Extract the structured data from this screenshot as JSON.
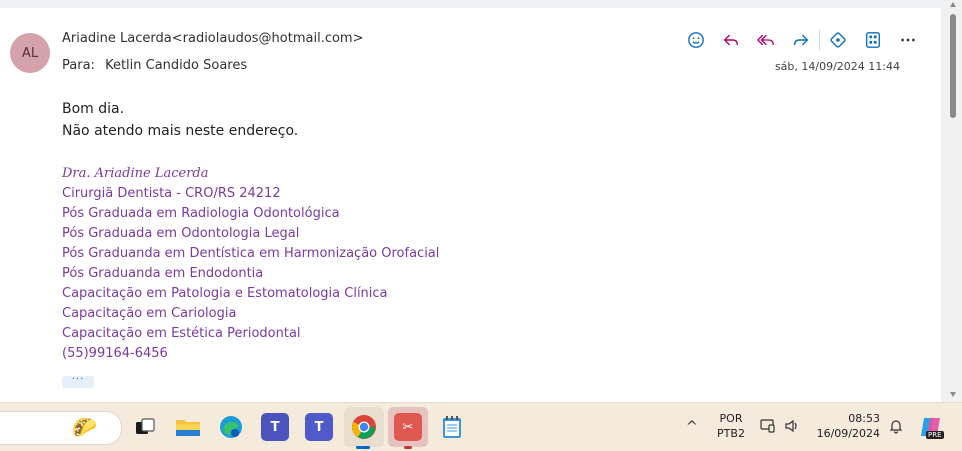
{
  "email": {
    "avatar_initials": "AL",
    "from": "Ariadine Lacerda<radiolaudos@hotmail.com>",
    "to_label": "Para:",
    "to": "Ketlin Candido Soares",
    "date": "sáb, 14/09/2024 11:44",
    "body_lines": [
      "Bom dia.",
      "Não atendo mais neste endereço."
    ],
    "signature": [
      "Dra. Ariadine Lacerda",
      "Cirurgiã Dentista - CRO/RS 24212",
      "Pós Graduada em Radiologia Odontológica",
      "Pós Graduada em Odontologia Legal",
      "Pós Graduanda em Dentística em Harmonização Orofacial",
      "Pós Graduanda em Endodontia",
      "Capacitação em Patologia e Estomatologia Clínica",
      "Capacitação em Cariologia",
      "Capacitação em Estética Periodontal",
      "(55)99164-6456"
    ],
    "more_label": "···",
    "actions": [
      "emoji-icon",
      "reply-icon",
      "reply-all-icon",
      "forward-icon",
      "apps-icon",
      "immersive-reader-icon",
      "more-icon"
    ]
  },
  "taskbar": {
    "apps": [
      "taco-widget",
      "task-view",
      "file-explorer",
      "edge",
      "teams-classic",
      "teams",
      "chrome",
      "snipping-tool",
      "notepad"
    ],
    "tray": {
      "lang_top": "POR",
      "lang_bottom": "PTB2",
      "time": "08:53",
      "date": "16/09/2024",
      "copilot_badge": "PRE"
    }
  },
  "colors": {
    "avatar_bg": "#d5a1ab",
    "signature": "#7a3a9f",
    "accent": "#0f6cbd",
    "taskbar_bg": "#f5ebdc"
  }
}
